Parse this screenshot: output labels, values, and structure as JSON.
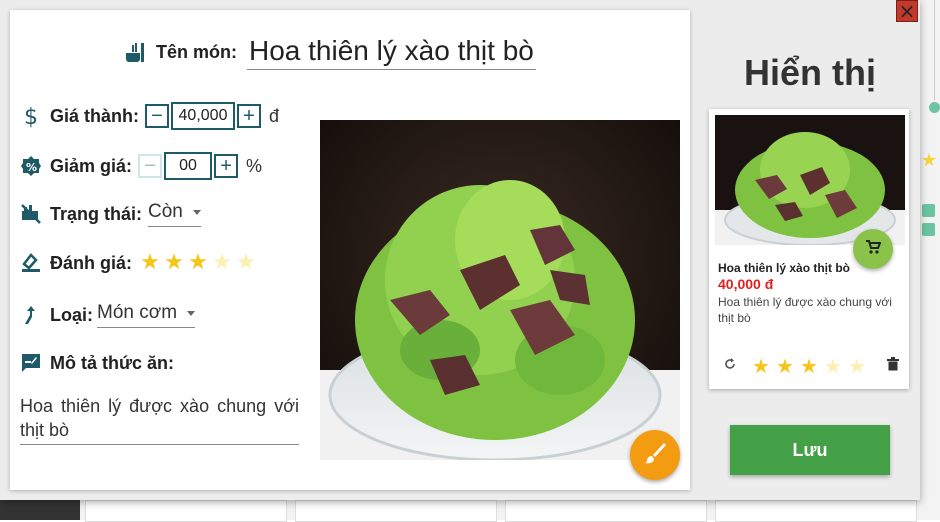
{
  "dialog": {
    "close_label": "×"
  },
  "form": {
    "name_label": "Tên món:",
    "name_value": "Hoa thiên lý xào thịt bò",
    "price_label": "Giá thành:",
    "price_value": "40,000",
    "price_unit": "đ",
    "discount_label": "Giảm giá:",
    "discount_value": "00",
    "discount_unit": "%",
    "status_label": "Trạng thái:",
    "status_value": "Còn",
    "rating_label": "Đánh giá:",
    "rating": 3,
    "rating_max": 5,
    "category_label": "Loại:",
    "category_value": "Món cơm",
    "description_label": "Mô tả thức ăn:",
    "description_value": "Hoa thiên lý được xào chung với thịt bò",
    "minus": "−",
    "plus": "+"
  },
  "preview": {
    "title": "Hiển thị",
    "card_name": "Hoa thiên lý xào thịt bò",
    "card_price": "40,000 đ",
    "card_description": "Hoa thiên lý được xào chung với thịt bò",
    "card_rating": 3
  },
  "actions": {
    "save_label": "Lưu"
  },
  "icons": {
    "name": "restaurant-icon",
    "price": "dollar-icon",
    "discount": "discount-icon",
    "status": "status-icon",
    "rating": "rating-icon",
    "category": "category-icon",
    "description": "description-icon",
    "edit_image": "brush-icon",
    "cart": "cart-icon",
    "refresh": "refresh-icon",
    "delete": "trash-icon"
  },
  "colors": {
    "accent": "#1f5b66",
    "save": "#43a047",
    "price": "#e02020",
    "brush": "#f39c12",
    "cart": "#8bc34a",
    "star": "#f5c518"
  }
}
